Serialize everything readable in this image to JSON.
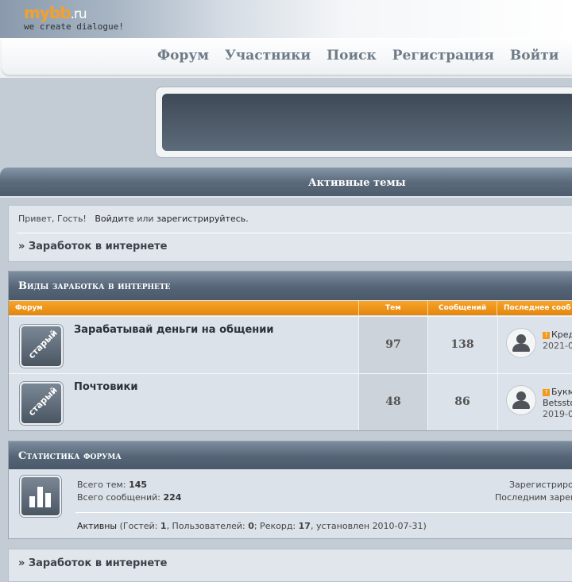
{
  "logo": {
    "main": "mybb",
    "suffix": ".ru",
    "tagline": "we create dialogue!"
  },
  "nav": {
    "items": [
      "Форум",
      "Участники",
      "Поиск",
      "Регистрация",
      "Войти"
    ]
  },
  "active_topics": {
    "label": "Активные темы"
  },
  "greeting": {
    "hello": "Привет, Гость!",
    "login_link": "Войдите",
    "or": "или",
    "register_link": "зарегистрируйтесь."
  },
  "breadcrumb": "» Заработок в интернете",
  "category": {
    "title": "Виды заработка в интернете",
    "columns": {
      "forum": "Форум",
      "topics": "Тем",
      "posts": "Сообщений",
      "last": "Последнее сооб"
    },
    "forums": [
      {
        "icon_label": "старый",
        "name": "Зарабатывай деньги на общении",
        "topics": "97",
        "posts": "138",
        "last_title": "Кред",
        "last_author": "",
        "last_date": "2021-0"
      },
      {
        "icon_label": "старый",
        "name": "Почтовики",
        "topics": "48",
        "posts": "86",
        "last_title": "Букм",
        "last_author": "Betssto",
        "last_date": "2019-0"
      }
    ]
  },
  "stats": {
    "title": "Статистика форума",
    "total_topics_label": "Всего тем:",
    "total_topics": "145",
    "total_posts_label": "Всего сообщений:",
    "total_posts": "224",
    "registered_label": "Зарегистриро",
    "last_registered_label": "Последним зарег",
    "active_label": "Активны",
    "guests_label": "(Гостей:",
    "guests": "1",
    "users_label": ", Пользователей:",
    "users": "0",
    "record_label": "; Рекорд:",
    "record": "17",
    "record_date_label": ", установлен",
    "record_date": "2010-07-31",
    "close_paren": ")"
  },
  "colors": {
    "accent": "#f39a1a",
    "header_bar": "#556577",
    "background": "#c3ccd5"
  }
}
